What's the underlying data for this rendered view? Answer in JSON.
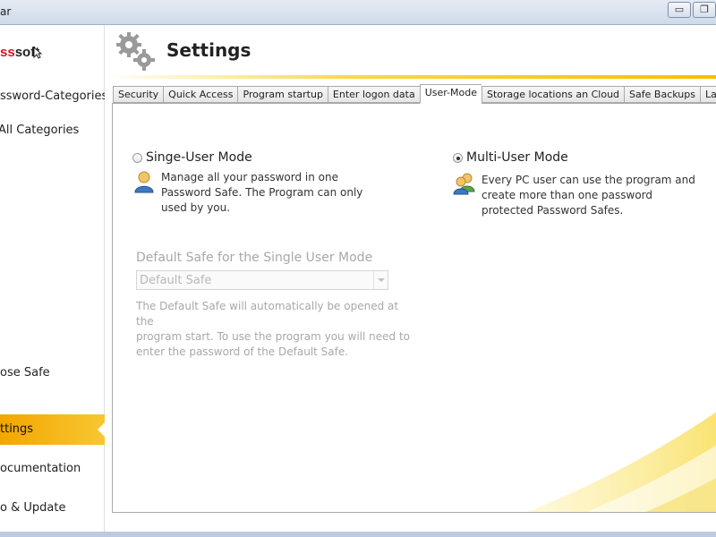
{
  "window": {
    "title": "ar",
    "buttons": [
      "▭",
      "❐"
    ]
  },
  "sidebar": {
    "logo_red": "ss",
    "logo_dark": "soft",
    "items": [
      {
        "label": "ssword-Categories"
      },
      {
        "label": "All Categories"
      },
      {
        "label": "ose Safe"
      },
      {
        "label": "ttings",
        "active": true
      },
      {
        "label": "ocumentation"
      },
      {
        "label": "o & Update"
      }
    ]
  },
  "header": {
    "title": "Settings"
  },
  "tabs": [
    {
      "label": "Security"
    },
    {
      "label": "Quick Access"
    },
    {
      "label": "Program startup"
    },
    {
      "label": "Enter logon data"
    },
    {
      "label": "User-Mode",
      "active": true
    },
    {
      "label": "Storage locations an Cloud"
    },
    {
      "label": "Safe Backups"
    },
    {
      "label": "Language"
    }
  ],
  "user_mode": {
    "single": {
      "label": "Singe-User Mode",
      "checked": false,
      "desc_lines": [
        "Manage all your password in one",
        "Password Safe. The Program can only",
        "used by you."
      ]
    },
    "multi": {
      "label": "Multi-User Mode",
      "checked": true,
      "desc_lines": [
        "Every PC user can use the program and",
        "create more than one password",
        "protected Password Safes."
      ]
    },
    "default_safe": {
      "label": "Default Safe for the Single User Mode",
      "value": "Default Safe",
      "desc_lines": [
        "The Default Safe will automatically be opened at the",
        "program start. To use the program you will need to",
        "enter the password of the Default Safe."
      ]
    }
  },
  "colors": {
    "accent": "#f3a600",
    "accent_light": "#f8c632",
    "logo_red": "#d01818"
  }
}
